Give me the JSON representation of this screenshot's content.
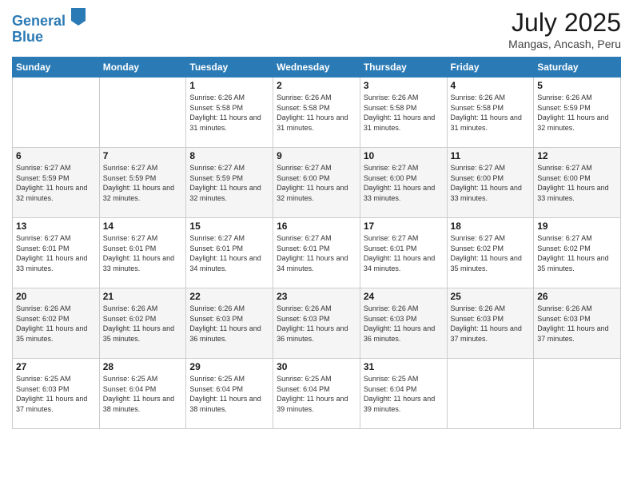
{
  "logo": {
    "line1": "General",
    "line2": "Blue"
  },
  "title": "July 2025",
  "subtitle": "Mangas, Ancash, Peru",
  "days_header": [
    "Sunday",
    "Monday",
    "Tuesday",
    "Wednesday",
    "Thursday",
    "Friday",
    "Saturday"
  ],
  "weeks": [
    [
      {
        "num": "",
        "sunrise": "",
        "sunset": "",
        "daylight": ""
      },
      {
        "num": "",
        "sunrise": "",
        "sunset": "",
        "daylight": ""
      },
      {
        "num": "1",
        "sunrise": "Sunrise: 6:26 AM",
        "sunset": "Sunset: 5:58 PM",
        "daylight": "Daylight: 11 hours and 31 minutes."
      },
      {
        "num": "2",
        "sunrise": "Sunrise: 6:26 AM",
        "sunset": "Sunset: 5:58 PM",
        "daylight": "Daylight: 11 hours and 31 minutes."
      },
      {
        "num": "3",
        "sunrise": "Sunrise: 6:26 AM",
        "sunset": "Sunset: 5:58 PM",
        "daylight": "Daylight: 11 hours and 31 minutes."
      },
      {
        "num": "4",
        "sunrise": "Sunrise: 6:26 AM",
        "sunset": "Sunset: 5:58 PM",
        "daylight": "Daylight: 11 hours and 31 minutes."
      },
      {
        "num": "5",
        "sunrise": "Sunrise: 6:26 AM",
        "sunset": "Sunset: 5:59 PM",
        "daylight": "Daylight: 11 hours and 32 minutes."
      }
    ],
    [
      {
        "num": "6",
        "sunrise": "Sunrise: 6:27 AM",
        "sunset": "Sunset: 5:59 PM",
        "daylight": "Daylight: 11 hours and 32 minutes."
      },
      {
        "num": "7",
        "sunrise": "Sunrise: 6:27 AM",
        "sunset": "Sunset: 5:59 PM",
        "daylight": "Daylight: 11 hours and 32 minutes."
      },
      {
        "num": "8",
        "sunrise": "Sunrise: 6:27 AM",
        "sunset": "Sunset: 5:59 PM",
        "daylight": "Daylight: 11 hours and 32 minutes."
      },
      {
        "num": "9",
        "sunrise": "Sunrise: 6:27 AM",
        "sunset": "Sunset: 6:00 PM",
        "daylight": "Daylight: 11 hours and 32 minutes."
      },
      {
        "num": "10",
        "sunrise": "Sunrise: 6:27 AM",
        "sunset": "Sunset: 6:00 PM",
        "daylight": "Daylight: 11 hours and 33 minutes."
      },
      {
        "num": "11",
        "sunrise": "Sunrise: 6:27 AM",
        "sunset": "Sunset: 6:00 PM",
        "daylight": "Daylight: 11 hours and 33 minutes."
      },
      {
        "num": "12",
        "sunrise": "Sunrise: 6:27 AM",
        "sunset": "Sunset: 6:00 PM",
        "daylight": "Daylight: 11 hours and 33 minutes."
      }
    ],
    [
      {
        "num": "13",
        "sunrise": "Sunrise: 6:27 AM",
        "sunset": "Sunset: 6:01 PM",
        "daylight": "Daylight: 11 hours and 33 minutes."
      },
      {
        "num": "14",
        "sunrise": "Sunrise: 6:27 AM",
        "sunset": "Sunset: 6:01 PM",
        "daylight": "Daylight: 11 hours and 33 minutes."
      },
      {
        "num": "15",
        "sunrise": "Sunrise: 6:27 AM",
        "sunset": "Sunset: 6:01 PM",
        "daylight": "Daylight: 11 hours and 34 minutes."
      },
      {
        "num": "16",
        "sunrise": "Sunrise: 6:27 AM",
        "sunset": "Sunset: 6:01 PM",
        "daylight": "Daylight: 11 hours and 34 minutes."
      },
      {
        "num": "17",
        "sunrise": "Sunrise: 6:27 AM",
        "sunset": "Sunset: 6:01 PM",
        "daylight": "Daylight: 11 hours and 34 minutes."
      },
      {
        "num": "18",
        "sunrise": "Sunrise: 6:27 AM",
        "sunset": "Sunset: 6:02 PM",
        "daylight": "Daylight: 11 hours and 35 minutes."
      },
      {
        "num": "19",
        "sunrise": "Sunrise: 6:27 AM",
        "sunset": "Sunset: 6:02 PM",
        "daylight": "Daylight: 11 hours and 35 minutes."
      }
    ],
    [
      {
        "num": "20",
        "sunrise": "Sunrise: 6:26 AM",
        "sunset": "Sunset: 6:02 PM",
        "daylight": "Daylight: 11 hours and 35 minutes."
      },
      {
        "num": "21",
        "sunrise": "Sunrise: 6:26 AM",
        "sunset": "Sunset: 6:02 PM",
        "daylight": "Daylight: 11 hours and 35 minutes."
      },
      {
        "num": "22",
        "sunrise": "Sunrise: 6:26 AM",
        "sunset": "Sunset: 6:03 PM",
        "daylight": "Daylight: 11 hours and 36 minutes."
      },
      {
        "num": "23",
        "sunrise": "Sunrise: 6:26 AM",
        "sunset": "Sunset: 6:03 PM",
        "daylight": "Daylight: 11 hours and 36 minutes."
      },
      {
        "num": "24",
        "sunrise": "Sunrise: 6:26 AM",
        "sunset": "Sunset: 6:03 PM",
        "daylight": "Daylight: 11 hours and 36 minutes."
      },
      {
        "num": "25",
        "sunrise": "Sunrise: 6:26 AM",
        "sunset": "Sunset: 6:03 PM",
        "daylight": "Daylight: 11 hours and 37 minutes."
      },
      {
        "num": "26",
        "sunrise": "Sunrise: 6:26 AM",
        "sunset": "Sunset: 6:03 PM",
        "daylight": "Daylight: 11 hours and 37 minutes."
      }
    ],
    [
      {
        "num": "27",
        "sunrise": "Sunrise: 6:25 AM",
        "sunset": "Sunset: 6:03 PM",
        "daylight": "Daylight: 11 hours and 37 minutes."
      },
      {
        "num": "28",
        "sunrise": "Sunrise: 6:25 AM",
        "sunset": "Sunset: 6:04 PM",
        "daylight": "Daylight: 11 hours and 38 minutes."
      },
      {
        "num": "29",
        "sunrise": "Sunrise: 6:25 AM",
        "sunset": "Sunset: 6:04 PM",
        "daylight": "Daylight: 11 hours and 38 minutes."
      },
      {
        "num": "30",
        "sunrise": "Sunrise: 6:25 AM",
        "sunset": "Sunset: 6:04 PM",
        "daylight": "Daylight: 11 hours and 39 minutes."
      },
      {
        "num": "31",
        "sunrise": "Sunrise: 6:25 AM",
        "sunset": "Sunset: 6:04 PM",
        "daylight": "Daylight: 11 hours and 39 minutes."
      },
      {
        "num": "",
        "sunrise": "",
        "sunset": "",
        "daylight": ""
      },
      {
        "num": "",
        "sunrise": "",
        "sunset": "",
        "daylight": ""
      }
    ]
  ]
}
